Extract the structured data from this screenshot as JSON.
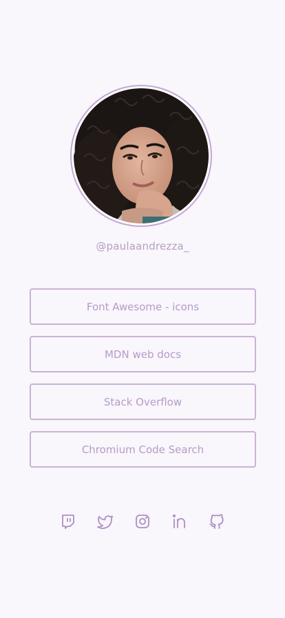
{
  "profile": {
    "handle": "@paulaandrezza_",
    "avatar_icon": "profile-photo"
  },
  "links": [
    {
      "label": "Font Awesome - icons"
    },
    {
      "label": "MDN web docs"
    },
    {
      "label": "Stack Overflow"
    },
    {
      "label": "Chromium Code Search"
    }
  ],
  "social": [
    {
      "icon": "twitch-icon"
    },
    {
      "icon": "twitter-icon"
    },
    {
      "icon": "instagram-icon"
    },
    {
      "icon": "linkedin-icon"
    },
    {
      "icon": "github-icon"
    }
  ],
  "colors": {
    "background": "#f9f6fc",
    "accent": "#c3a8d4",
    "text": "#b49cc6"
  }
}
